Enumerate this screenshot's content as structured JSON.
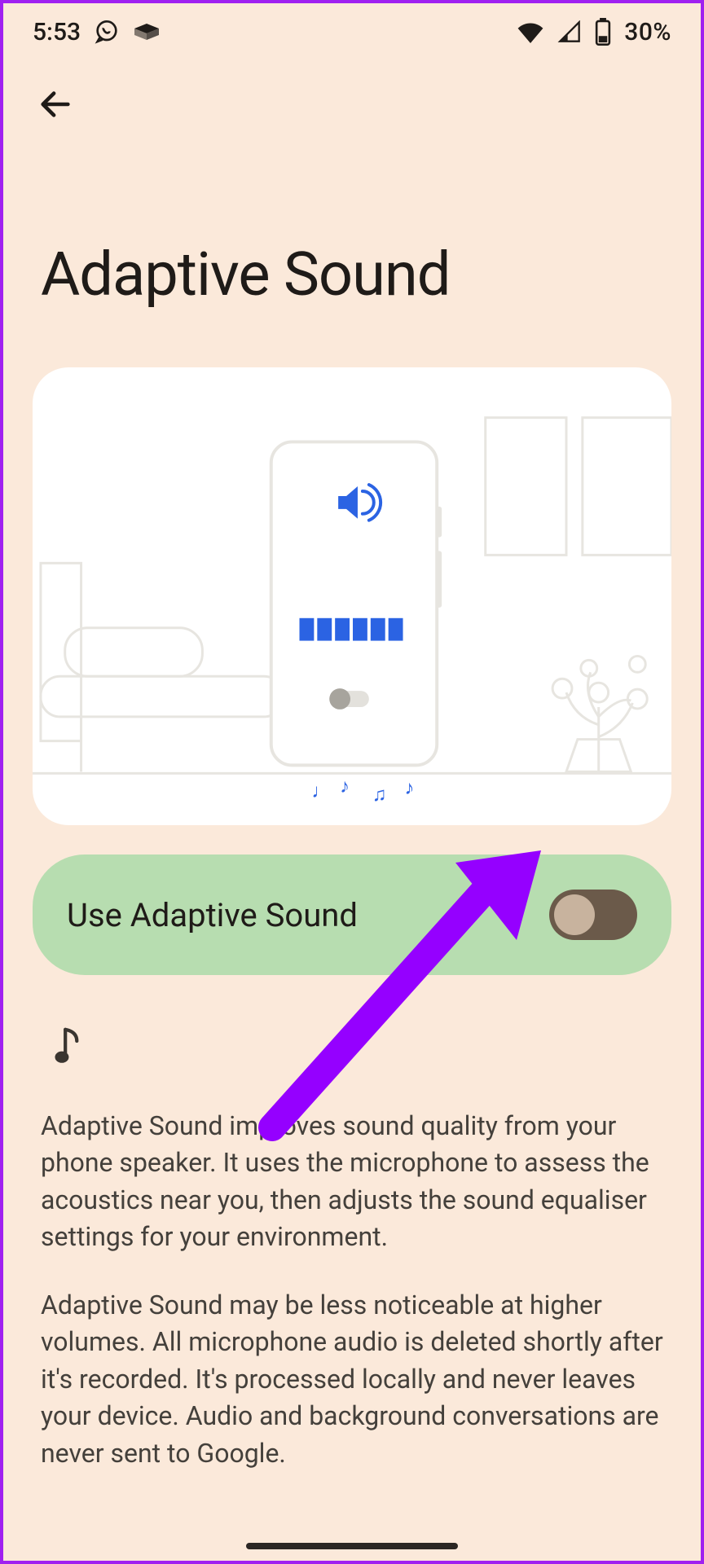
{
  "status": {
    "time": "5:53",
    "battery_pct": "30%"
  },
  "page": {
    "title": "Adaptive Sound"
  },
  "toggle": {
    "label": "Use Adaptive Sound",
    "on": false
  },
  "info": {
    "p1": "Adaptive Sound improves sound quality from your phone speaker. It uses the microphone to assess the acoustics near you, then adjusts the sound equaliser settings for your environment.",
    "p2": "Adaptive Sound may be less noticeable at higher volumes. All microphone audio is deleted shortly after it's recorded. It's processed locally and never leaves your device. Audio and background conversations are never sent to Google."
  },
  "annotation": {
    "arrow_color": "#9500ff"
  }
}
